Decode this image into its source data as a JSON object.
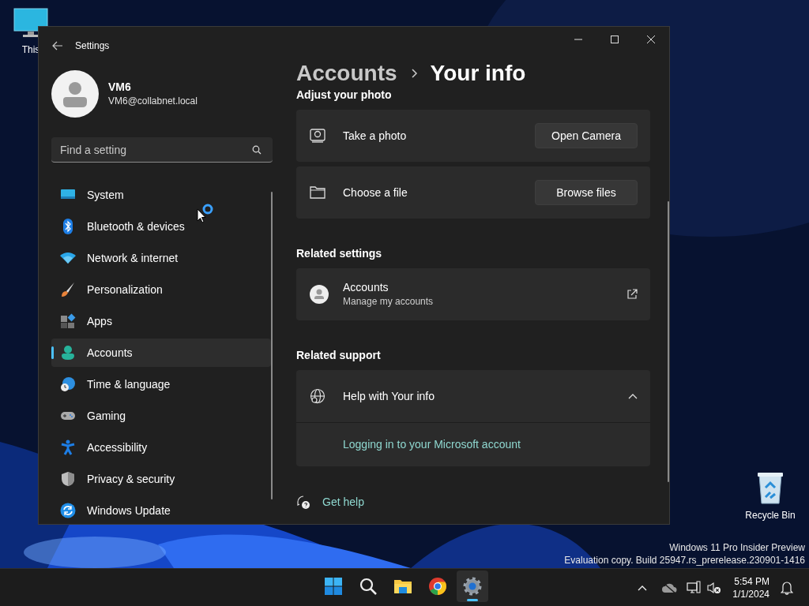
{
  "desktop": {
    "icons": [
      {
        "kind": "pc",
        "label": "This"
      },
      {
        "kind": "recycle",
        "label": "Recycle Bin"
      }
    ],
    "watermark": [
      "Windows 11 Pro Insider Preview",
      "Evaluation copy. Build 25947.rs_prerelease.230901-1416"
    ]
  },
  "window": {
    "title": "Settings"
  },
  "profile": {
    "name": "VM6",
    "email": "VM6@collabnet.local"
  },
  "search": {
    "placeholder": "Find a setting"
  },
  "nav": [
    {
      "kind": "system",
      "label": "System",
      "selected": false
    },
    {
      "kind": "bluetooth",
      "label": "Bluetooth & devices",
      "selected": false
    },
    {
      "kind": "network",
      "label": "Network & internet",
      "selected": false
    },
    {
      "kind": "personalization",
      "label": "Personalization",
      "selected": false
    },
    {
      "kind": "apps",
      "label": "Apps",
      "selected": false
    },
    {
      "kind": "accounts",
      "label": "Accounts",
      "selected": true
    },
    {
      "kind": "time",
      "label": "Time & language",
      "selected": false
    },
    {
      "kind": "gaming",
      "label": "Gaming",
      "selected": false
    },
    {
      "kind": "accessibility",
      "label": "Accessibility",
      "selected": false
    },
    {
      "kind": "privacy",
      "label": "Privacy & security",
      "selected": false
    },
    {
      "kind": "update",
      "label": "Windows Update",
      "selected": false
    }
  ],
  "breadcrumb": [
    "Accounts",
    "Your info"
  ],
  "sections": [
    {
      "heading": "Adjust your photo",
      "rows": [
        {
          "kind": "action",
          "label": "Take a photo",
          "button": "Open Camera"
        },
        {
          "kind": "action",
          "label": "Choose a file",
          "button": "Browse files"
        }
      ]
    },
    {
      "heading": "Related settings",
      "rows": [
        {
          "kind": "link",
          "label": "Accounts",
          "description": "Manage my accounts"
        }
      ]
    },
    {
      "heading": "Related support",
      "rows": [
        {
          "kind": "expander",
          "label": "Help with Your info",
          "expanded": true,
          "links": [
            "Logging in to your Microsoft account"
          ]
        }
      ]
    }
  ],
  "get_help": "Get help",
  "taskbar": {
    "apps": [
      {
        "kind": "start",
        "selected": false
      },
      {
        "kind": "search",
        "selected": false
      },
      {
        "kind": "explorer",
        "selected": false
      },
      {
        "kind": "chrome",
        "selected": false
      },
      {
        "kind": "settings",
        "selected": true
      }
    ],
    "time": "5:54 PM",
    "date": "1/1/2024"
  }
}
